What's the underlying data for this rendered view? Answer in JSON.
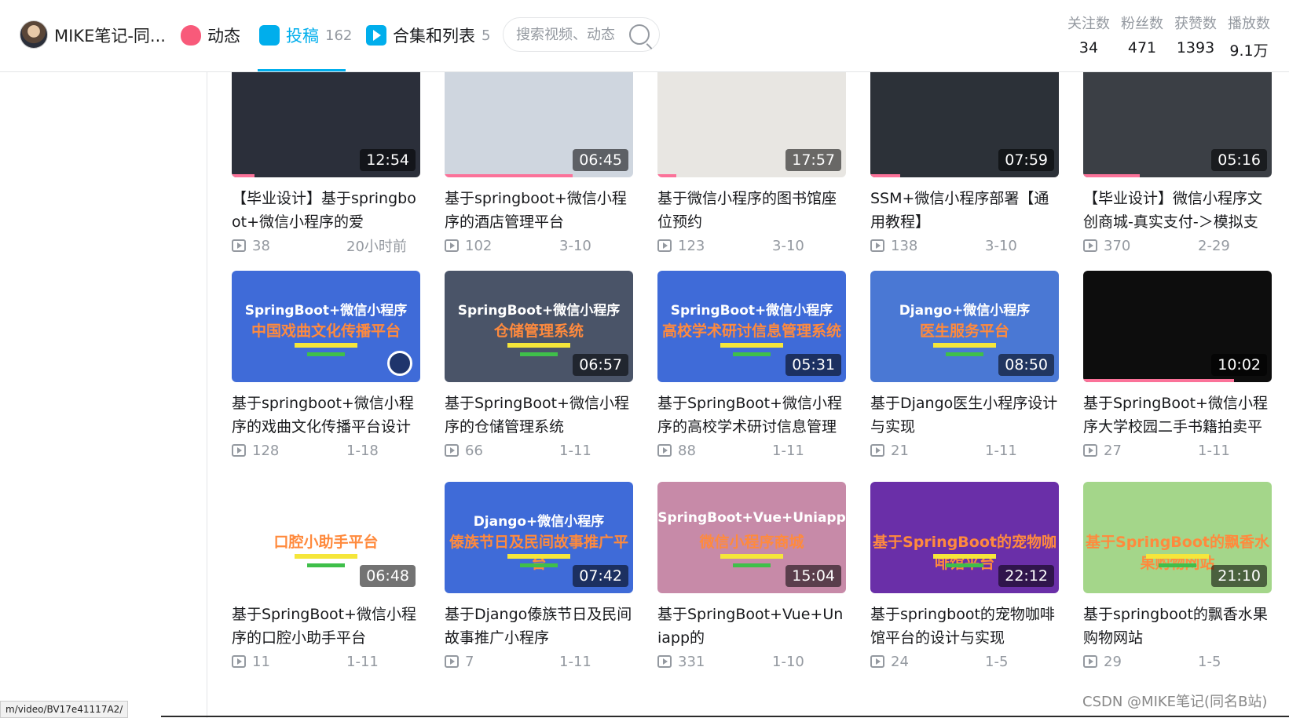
{
  "header": {
    "username": "MIKE笔记-同...",
    "nav": {
      "dynamic": {
        "label": "动态"
      },
      "uploads": {
        "label": "投稿",
        "count": "162"
      },
      "collections": {
        "label": "合集和列表",
        "count": "5"
      }
    },
    "search": {
      "placeholder": "搜索视频、动态"
    },
    "stats": [
      {
        "label": "关注数",
        "value": "34"
      },
      {
        "label": "粉丝数",
        "value": "471"
      },
      {
        "label": "获赞数",
        "value": "1393"
      },
      {
        "label": "播放数",
        "value": "9.1万"
      }
    ]
  },
  "videos": [
    {
      "title": "【毕业设计】基于springboot+微信小程序的爱",
      "duration": "12:54",
      "views": "38",
      "date": "20小时前",
      "thumb_line1": "",
      "thumb_line2": "",
      "thumb_bg": "#2b2f3a",
      "progress": 0.12
    },
    {
      "title": "基于springboot+微信小程序的酒店管理平台",
      "duration": "06:45",
      "views": "102",
      "date": "3-10",
      "thumb_line1": "",
      "thumb_line2": "",
      "thumb_bg": "#cfd6df",
      "progress": 0.68
    },
    {
      "title": "基于微信小程序的图书馆座位预约",
      "duration": "17:57",
      "views": "123",
      "date": "3-10",
      "thumb_line1": "",
      "thumb_line2": "",
      "thumb_bg": "#e8e6e2",
      "progress": 0.1
    },
    {
      "title": "SSM+微信小程序部署【通用教程】",
      "duration": "07:59",
      "views": "138",
      "date": "3-10",
      "thumb_line1": "",
      "thumb_line2": "",
      "thumb_bg": "#2c3138",
      "progress": 0.16
    },
    {
      "title": "【毕业设计】微信小程序文创商城-真实支付-＞模拟支付",
      "duration": "05:16",
      "views": "370",
      "date": "2-29",
      "thumb_line1": "",
      "thumb_line2": "",
      "thumb_bg": "#3b3f45",
      "progress": 0.3
    },
    {
      "title": "基于springboot+微信小程序的戏曲文化传播平台设计与实",
      "duration": "",
      "views": "128",
      "date": "1-18",
      "thumb_line1": "SpringBoot+微信小程序",
      "thumb_line2": "中国戏曲文化传播平台",
      "thumb_bg": "#3f6bd8",
      "progress": 0
    },
    {
      "title": "基于SpringBoot+微信小程序的仓储管理系统",
      "duration": "06:57",
      "views": "66",
      "date": "1-11",
      "thumb_line1": "SpringBoot+微信小程序",
      "thumb_line2": "仓储管理系统",
      "thumb_bg": "#4a5468",
      "progress": 0
    },
    {
      "title": "基于SpringBoot+微信小程序的高校学术研讨信息管理系统",
      "duration": "05:31",
      "views": "88",
      "date": "1-11",
      "thumb_line1": "SpringBoot+微信小程序",
      "thumb_line2": "高校学术研讨信息管理系统",
      "thumb_bg": "#3f6bd8",
      "progress": 0
    },
    {
      "title": "基于Django医生小程序设计与实现",
      "duration": "08:50",
      "views": "21",
      "date": "1-11",
      "thumb_line1": "Django+微信小程序",
      "thumb_line2": "医生服务平台",
      "thumb_bg": "#4a78d4",
      "progress": 0
    },
    {
      "title": "基于SpringBoot+微信小程序大学校园二手书籍拍卖平台",
      "duration": "10:02",
      "views": "27",
      "date": "1-11",
      "thumb_line1": "",
      "thumb_line2": "",
      "thumb_bg": "#0d0d0d",
      "progress": 0.8
    },
    {
      "title": "基于SpringBoot+微信小程序的口腔小助手平台",
      "duration": "06:48",
      "views": "11",
      "date": "1-11",
      "thumb_line1": "",
      "thumb_line2": "口腔小助手平台",
      "thumb_bg": "#ffffff",
      "progress": 0
    },
    {
      "title": "基于Django傣族节日及民间故事推广小程序",
      "duration": "07:42",
      "views": "7",
      "date": "1-11",
      "thumb_line1": "Django+微信小程序",
      "thumb_line2": "傣族节日及民间故事推广平台",
      "thumb_bg": "#3f6bd8",
      "progress": 0
    },
    {
      "title": "基于SpringBoot+Vue+Uniapp的",
      "duration": "15:04",
      "views": "331",
      "date": "1-10",
      "thumb_line1": "SpringBoot+Vue+Uniapp",
      "thumb_line2": "微信小程序商城",
      "thumb_bg": "#c78aa8",
      "progress": 0
    },
    {
      "title": "基于springboot的宠物咖啡馆平台的设计与实现",
      "duration": "22:12",
      "views": "24",
      "date": "1-5",
      "thumb_line1": "",
      "thumb_line2": "基于SpringBoot的宠物咖啡馆平台",
      "thumb_bg": "#6a2fa8",
      "progress": 0
    },
    {
      "title": "基于springboot的飘香水果购物网站",
      "duration": "21:10",
      "views": "29",
      "date": "1-5",
      "thumb_line1": "",
      "thumb_line2": "基于SpringBoot的飘香水果购物网站",
      "thumb_bg": "#a4d68a",
      "progress": 0
    }
  ],
  "status_url": "m/video/BV17e41117A2/",
  "watermark": "CSDN @MIKE笔记(同名B站)"
}
